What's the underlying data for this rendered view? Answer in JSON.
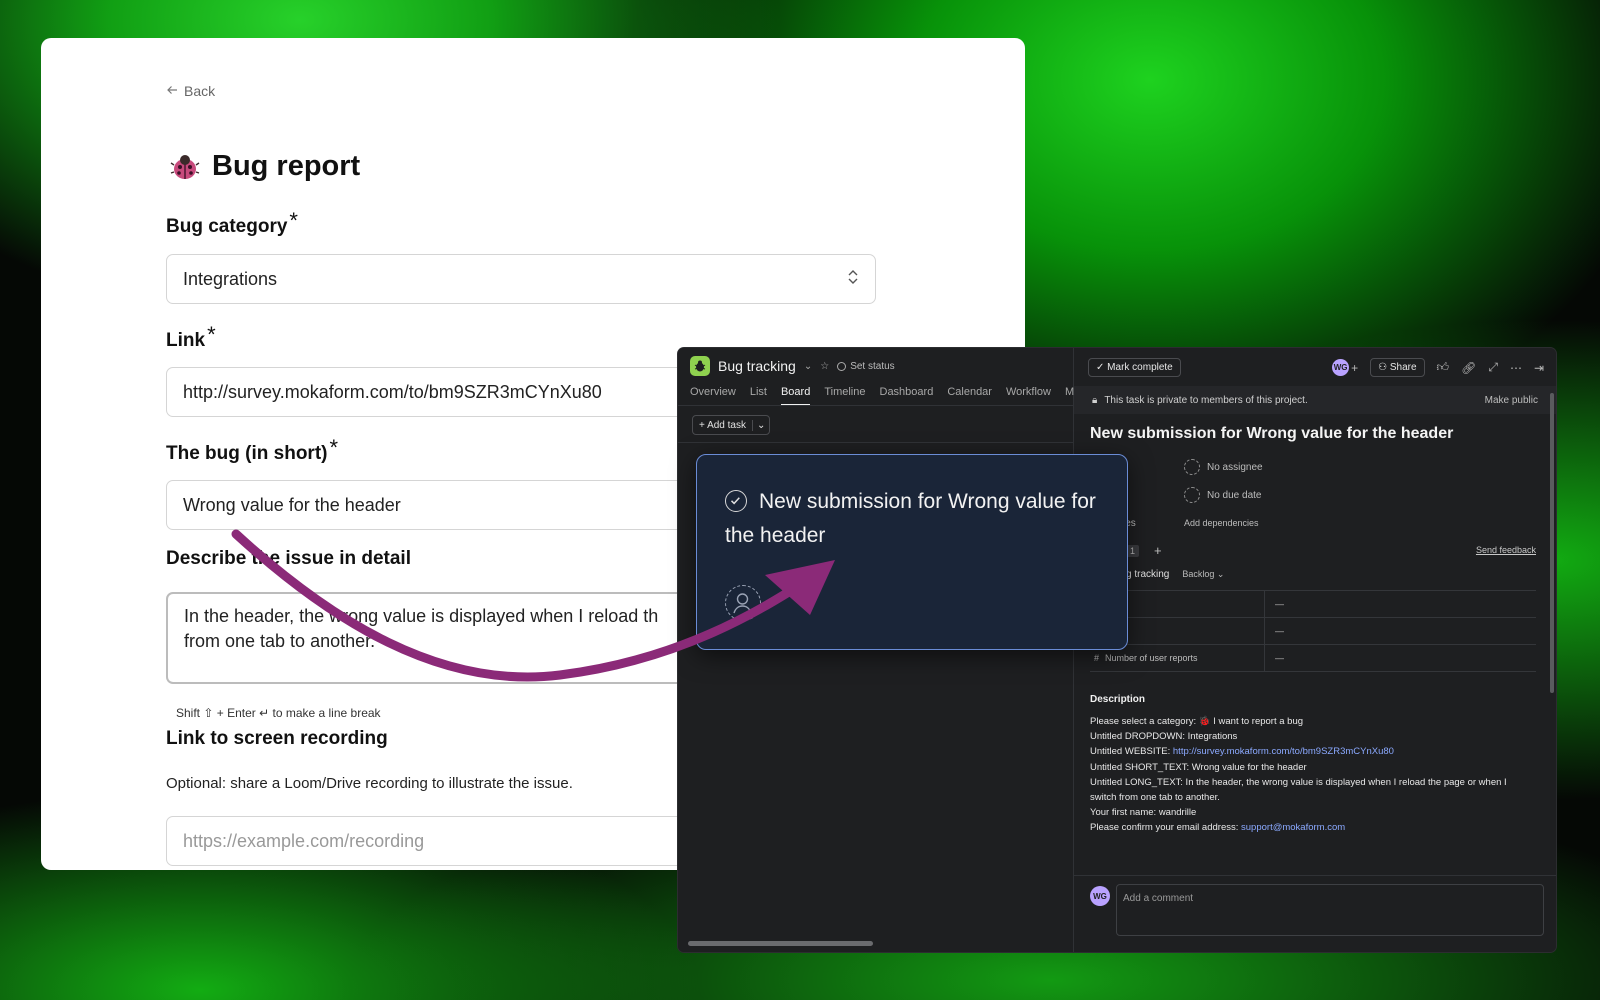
{
  "form": {
    "back_label": "Back",
    "title": "Bug report",
    "q1": {
      "label": "Bug category",
      "required_mark": "*",
      "value": "Integrations"
    },
    "q2": {
      "label": "Link",
      "required_mark": "*",
      "value": "http://survey.mokaform.com/to/bm9SZR3mCYnXu80"
    },
    "q3": {
      "label": "The bug (in short)",
      "required_mark": "*",
      "value": "Wrong value for the header"
    },
    "q4": {
      "label": "Describe the issue in detail",
      "value_line1": "In the header, the wrong value is displayed when I reload th",
      "value_line2": "from one tab to another.",
      "hint": "Shift ⇧ + Enter ↵ to make a line break"
    },
    "q5": {
      "label": "Link to screen recording",
      "description": "Optional: share a Loom/Drive recording to illustrate the issue.",
      "placeholder": "https://example.com/recording"
    }
  },
  "asana": {
    "project_name": "Bug tracking",
    "set_status": "Set status",
    "tabs": [
      "Overview",
      "List",
      "Board",
      "Timeline",
      "Dashboard",
      "Calendar",
      "Workflow",
      "Mess"
    ],
    "active_tab": "Board",
    "add_task": "Add task",
    "mark_complete": "Mark complete",
    "avatar_initials": "WG",
    "share": "Share",
    "private_notice": "This task is private to members of this project.",
    "make_public": "Make public",
    "task_title": "New submission for Wrong value for the header",
    "no_assignee": "No assignee",
    "no_due_date": "No due date",
    "dependencies_partial": "cies",
    "add_dependencies": "Add dependencies",
    "projects_count": "1",
    "send_feedback": "Send feedback",
    "project_partial": "g tracking",
    "section": "Backlog",
    "fields": [
      {
        "name": "y",
        "value": "—"
      },
      {
        "name": "er",
        "value": "—"
      },
      {
        "name": "Number of user reports",
        "value": "—"
      }
    ],
    "description_heading": "Description",
    "description_lines": {
      "l1": "Please select a category:  🐞 I want to report a bug",
      "l2": "Untitled DROPDOWN: Integrations",
      "l3_prefix": "Untitled WEBSITE: ",
      "l3_link": "http://survey.mokaform.com/to/bm9SZR3mCYnXu80",
      "l4": "Untitled SHORT_TEXT: Wrong value for the header",
      "l5": "Untitled LONG_TEXT: In the header, the wrong value is displayed when I reload the page or when I switch from one tab to another.",
      "l6": "Your first name: wandrille",
      "l7_prefix": "Please confirm your email address: ",
      "l7_link": "support@mokaform.com"
    },
    "comment_placeholder": "Add a comment"
  },
  "zoom_card": {
    "title": "New submission for Wrong value for the header"
  },
  "colors": {
    "arrow": "#8b2a78",
    "zoom_card_bg": "#1a2538",
    "zoom_card_border": "#6a8cd6",
    "asana_bg": "#1e1f21",
    "link": "#8ba9ff"
  }
}
